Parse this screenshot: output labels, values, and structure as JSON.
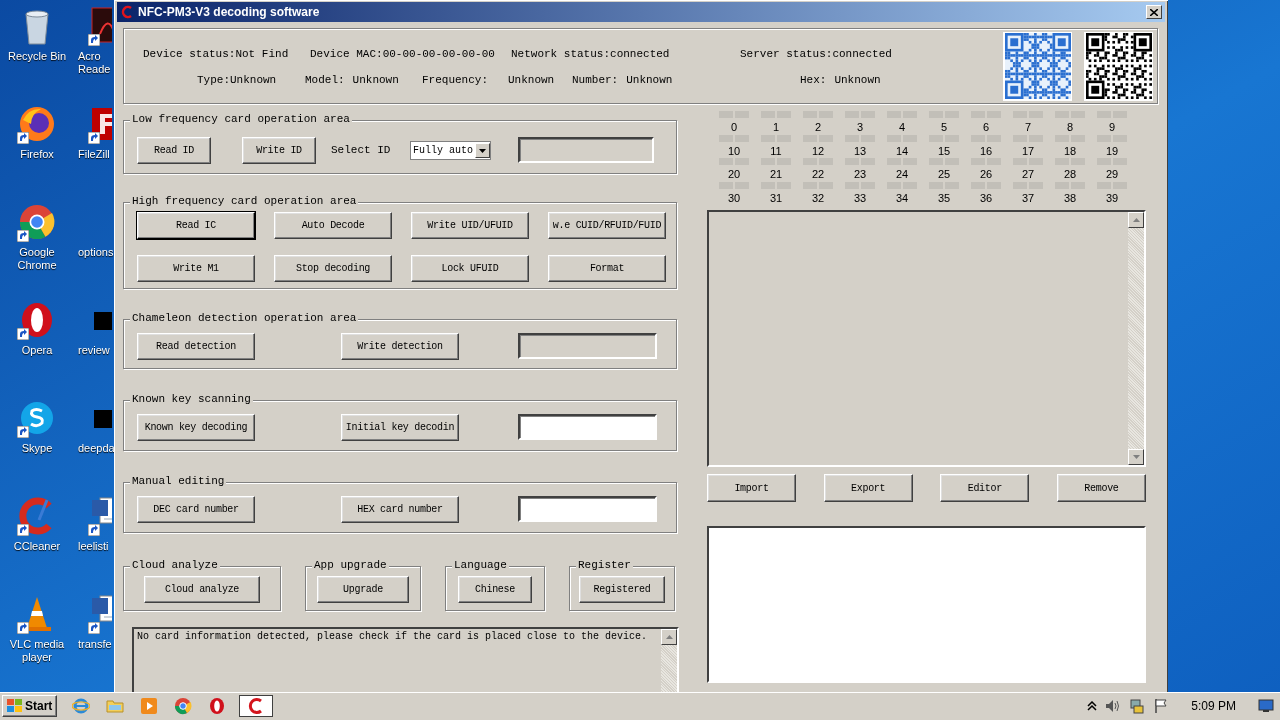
{
  "desktop": {
    "icons": [
      {
        "kind": "recycle-bin",
        "label": "Recycle Bin",
        "shortcut": false
      },
      {
        "kind": "firefox",
        "label": "Firefox",
        "shortcut": true
      },
      {
        "kind": "chrome",
        "label": "Google Chrome",
        "shortcut": true
      },
      {
        "kind": "opera",
        "label": "Opera",
        "shortcut": true
      },
      {
        "kind": "skype",
        "label": "Skype",
        "shortcut": true
      },
      {
        "kind": "ccleaner",
        "label": "CCleaner",
        "shortcut": true
      },
      {
        "kind": "vlc",
        "label": "VLC media player",
        "shortcut": true
      },
      {
        "kind": "acrobat",
        "label": "Acro Reade",
        "shortcut": true
      },
      {
        "kind": "filezilla",
        "label": "FileZill",
        "shortcut": true
      },
      {
        "kind": "blank",
        "label": "options",
        "shortcut": false
      },
      {
        "kind": "black-file",
        "label": "review",
        "shortcut": false
      },
      {
        "kind": "black-file",
        "label": "deepda",
        "shortcut": false
      },
      {
        "kind": "word",
        "label": "leelisti",
        "shortcut": true
      },
      {
        "kind": "word",
        "label": "transfe",
        "shortcut": true
      }
    ]
  },
  "window": {
    "title": "NFC-PM3-V3 decoding software"
  },
  "device_info": {
    "row_1": [
      {
        "label": "Device status:",
        "value": "Not Find"
      },
      {
        "label": "Device MAC:",
        "value": "00-00-00-00-00-00"
      },
      {
        "label": "Network status:",
        "value": "connected"
      },
      {
        "label": "Server status:",
        "value": "connected"
      }
    ],
    "row_2": [
      {
        "label": "Type:",
        "value": "Unknown"
      },
      {
        "label": "Model:",
        "value": "Unknown"
      },
      {
        "label": "Frequency:",
        "value": "Unknown"
      },
      {
        "label": "Number:",
        "value": "Unknown"
      },
      {
        "label": "Hex:",
        "value": "Unknown"
      }
    ]
  },
  "low_frequency": {
    "title": "Low frequency card operation area",
    "buttons": [
      "Read ID",
      "Write ID"
    ],
    "select_label": "Select ID",
    "select_value": "Fully auto",
    "field": {
      "disabled": true
    }
  },
  "high_frequency": {
    "title": "High frequency card operation area",
    "buttons": [
      {
        "label": "Read IC",
        "focused": true
      },
      {
        "label": "Auto Decode",
        "focused": false
      },
      {
        "label": "Write UID/UFUID",
        "focused": false
      },
      {
        "label": "w.e CUID/RFUID/FUID",
        "focused": false
      },
      {
        "label": "Write M1",
        "focused": false
      },
      {
        "label": "Stop decoding",
        "focused": false
      },
      {
        "label": "Lock UFUID",
        "focused": false
      },
      {
        "label": "Format",
        "focused": false
      }
    ]
  },
  "button_groups": [
    {
      "title": "Chameleon detection operation area",
      "buttons": [
        "Read detection",
        "Write detection"
      ],
      "field": {
        "disabled": true
      }
    },
    {
      "title": "Known key scanning",
      "buttons": [
        "Known key decoding",
        "Initial key decodin"
      ],
      "field": {
        "disabled": false
      }
    },
    {
      "title": "Manual editing",
      "buttons": [
        "DEC card number",
        "HEX card number"
      ],
      "field": {
        "disabled": false
      }
    }
  ],
  "small_groups": [
    {
      "title": "Cloud analyze",
      "button": "Cloud analyze"
    },
    {
      "title": "App upgrade",
      "button": "Upgrade"
    },
    {
      "title": "Language",
      "button": "Chinese"
    },
    {
      "title": "Register",
      "button": "Registered"
    }
  ],
  "log": {
    "text": "No card information detected, please check if the card is placed close to the device."
  },
  "sectors": [
    "0",
    "1",
    "2",
    "3",
    "4",
    "5",
    "6",
    "7",
    "8",
    "9",
    "10",
    "11",
    "12",
    "13",
    "14",
    "15",
    "16",
    "17",
    "18",
    "19",
    "20",
    "21",
    "22",
    "23",
    "24",
    "25",
    "26",
    "27",
    "28",
    "29",
    "30",
    "31",
    "32",
    "33",
    "34",
    "35",
    "36",
    "37",
    "38",
    "39"
  ],
  "list_buttons": [
    "Import",
    "Export",
    "Editor",
    "Remove"
  ],
  "taskbar": {
    "start": "Start",
    "apps": [
      {
        "kind": "ie",
        "active": false
      },
      {
        "kind": "folder",
        "active": false
      },
      {
        "kind": "media",
        "active": false
      },
      {
        "kind": "chrome",
        "active": false
      },
      {
        "kind": "opera",
        "active": false
      },
      {
        "kind": "nfc-app",
        "active": true
      }
    ],
    "clock": "5:09 PM"
  }
}
